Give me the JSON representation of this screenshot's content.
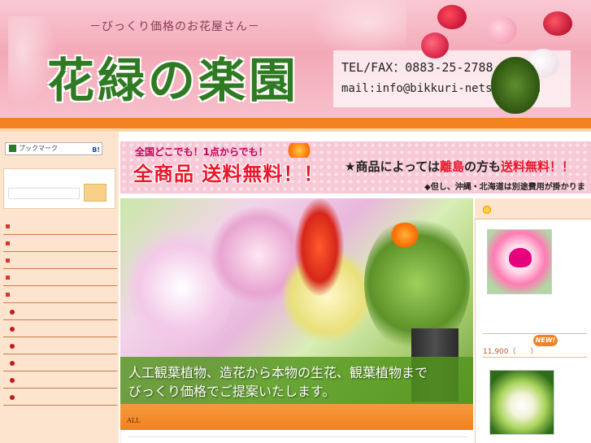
{
  "header": {
    "tagline": "－びっくり価格のお花屋さん－",
    "shop_name": "花緑の楽園",
    "tel_fax": "TEL/FAX：0883-25-2788",
    "mail": "mail:info@bikkuri-netshop.com"
  },
  "sidebar": {
    "bookmark_label": "ブックマーク",
    "bookmark_buttons": "B!",
    "search_placeholder": "",
    "items": [
      {
        "label": ""
      },
      {
        "label": ""
      },
      {
        "label": ""
      },
      {
        "label": ""
      },
      {
        "label": ""
      },
      {
        "label": ""
      },
      {
        "label": ""
      },
      {
        "label": ""
      },
      {
        "label": ""
      },
      {
        "label": ""
      },
      {
        "label": ""
      }
    ]
  },
  "banner": {
    "top_text": "全国どこでも！1点からでも！",
    "main_text": "全商品 送料無料！！",
    "note_prefix": "★商品によっては",
    "note_hl1": "離島",
    "note_mid": "の方も",
    "note_hl2": "送料無料！！",
    "note2": "◆但し、沖縄・北海道は別途費用が掛かります。"
  },
  "hero": {
    "caption_line1": "人工観葉植物、造花から本物の生花、観葉植物まで",
    "caption_line2": "びっくり価格でご提案いたします。"
  },
  "main": {
    "all_label": "ALL"
  },
  "right": {
    "price": "11,900（　　）",
    "new_badge": "NEW!"
  },
  "colors": {
    "accent_orange": "#f58220",
    "brand_green": "#2f7a22",
    "sale_red": "#e8172b",
    "header_pink": "#f4a9b8"
  }
}
